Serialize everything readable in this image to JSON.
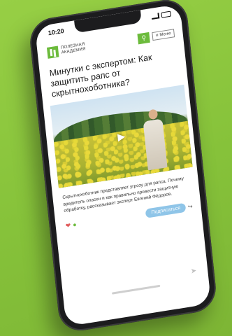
{
  "colors": {
    "background": "#8cc63f",
    "brand_green": "#6cbb3c",
    "subscribe_blue": "#8fc5e8",
    "phone_frame": "#1c1c1e"
  },
  "status_bar": {
    "time": "10:20"
  },
  "header": {
    "logo_line1": "ПОЛЕЗНАЯ",
    "logo_line2": "АКАДЕМИЯ",
    "menu_label": "Меню"
  },
  "article": {
    "title": "Минутки с экспертом: Как защитить рапс от скрытнохоботника?",
    "excerpt": "Скрытнохоботник представляет угрозу для рапса. Почему вредитель опасен и как правильно провести защитную обработку, рассказывает эксперт Евгений Фёдоров.",
    "subscribe_label": "Подписаться"
  },
  "icons": {
    "search": "search-icon",
    "menu": "menu-icon",
    "play": "play-icon",
    "share": "share-icon"
  }
}
